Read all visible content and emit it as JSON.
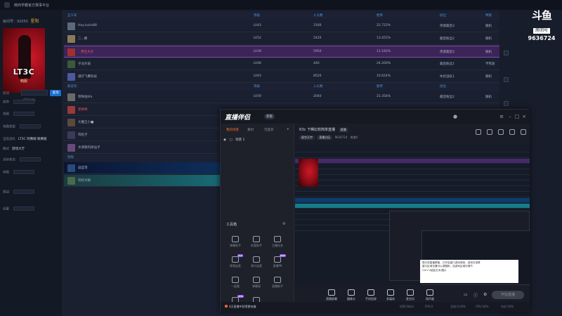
{
  "window": {
    "title": "微商学霸官方赛事平台"
  },
  "left_panel": {
    "room_label": "房间号：92055",
    "room_name": "星阳",
    "poster": {
      "logo_text": "LT3C",
      "sub_text": "韩服"
    },
    "search_label": "房间",
    "search_value": "LT3C战队",
    "search_button": "查询",
    "form_rows": [
      {
        "label": "排序",
        "value": ""
      },
      {
        "label": "地图",
        "value": ""
      },
      {
        "label": "地图类型",
        "value": ""
      },
      {
        "label": "当前战队",
        "value": "LT3C 阿赛姆 联赛服"
      },
      {
        "label": "模式",
        "value": "游戏大厅"
      },
      {
        "label": "当前状态",
        "value": ""
      },
      {
        "label": "地图",
        "value": ""
      },
      {
        "label": "观战",
        "value": ""
      },
      {
        "label": "设置",
        "value": ""
      }
    ]
  },
  "table": {
    "group1": {
      "name": "正义军",
      "cols": [
        "等级",
        "入头数",
        "胜率",
        "段位",
        "种族"
      ]
    },
    "rows1": [
      {
        "name": "Hey.lucks88",
        "level": "LV43",
        "count": "3160",
        "rate": "22.722%",
        "rank": "突袭最后3",
        "race": "随机",
        "avatar": "#5a6a7c"
      },
      {
        "name": "二...娜",
        "level": "LV52",
        "count": "5420",
        "rate": "13.455%",
        "rank": "最后粉丝2",
        "race": "随机",
        "avatar": "#8a7a5b"
      },
      {
        "name": "...帝王大大",
        "level": "LV39",
        "count": "5950",
        "rate": "11.182%",
        "rank": "突袭最后3",
        "race": "随机",
        "avatar": "#a03030",
        "hl": true
      },
      {
        "name": "子龙外居",
        "level": "LV46",
        "count": "440",
        "rate": "24.200%",
        "rank": "最后粉丝1",
        "race": "不死族",
        "avatar": "#3a5a3a"
      },
      {
        "name": "潮汐飞鹰科技",
        "level": "LV63",
        "count": "8520",
        "rate": "10.624%",
        "rank": "失控战队1",
        "race": "随机",
        "avatar": "#4b5a9a"
      }
    ],
    "group2": {
      "name": "邪恶军",
      "cols": [
        "等级",
        "入头数",
        "胜率",
        "段位",
        "种族"
      ]
    },
    "rows2": [
      {
        "name": "惊怖怕life",
        "level": "LV59",
        "count": "2040",
        "rate": "21.356%",
        "rank": "最后粉丝2",
        "race": "随机",
        "avatar": "#6a6a6a"
      },
      {
        "name": "老帅哥",
        "level": "",
        "count": "",
        "rate": "",
        "rank": "",
        "race": "",
        "avatar": "#9a3a3a",
        "red": true
      },
      {
        "name": "大魔王小■",
        "level": "",
        "count": "",
        "rate": "",
        "rank": "",
        "race": "",
        "avatar": "#5a4a3a"
      },
      {
        "name": "肉粒子",
        "level": "",
        "count": "",
        "rate": "",
        "rank": "",
        "race": "",
        "avatar": "#3a3a5a"
      },
      {
        "name": "水调歌的屎仙子",
        "level": "",
        "count": "",
        "rate": "",
        "rank": "",
        "race": "",
        "avatar": "#6a4a7a"
      }
    ],
    "group3": {
      "name": "围观"
    },
    "rows3": [
      {
        "name": "迦蓝雪",
        "avatar": "#2a4a7a",
        "style": "ganme"
      },
      {
        "name": "咬咬大眼",
        "avatar": "#4a6a4a",
        "style": "ganme2"
      }
    ]
  },
  "douyu": {
    "logo": "斗鱼",
    "badge": "房间号",
    "room_no": "9636724"
  },
  "companion": {
    "brand": "直播伴侣",
    "version": "新版",
    "tabs": [
      "我的场景",
      "素材",
      "可直装"
    ],
    "scene": "场景 1",
    "tools_label": "工具箱",
    "tools": [
      {
        "label": "弹幕助手",
        "tag": ""
      },
      {
        "label": "房管助手",
        "tag": ""
      },
      {
        "label": "主播任务",
        "tag": ""
      },
      {
        "label": "视频连麦",
        "tag": "HOT"
      },
      {
        "label": "观众连麦",
        "tag": ""
      },
      {
        "label": "直播PK",
        "tag": "NEW"
      },
      {
        "label": "一起看",
        "tag": ""
      },
      {
        "label": "弹幕塔",
        "tag": ""
      },
      {
        "label": "直播助手",
        "tag": ""
      },
      {
        "label": "特效",
        "tag": "NEW"
      },
      {
        "label": "更多",
        "tag": ""
      }
    ],
    "room_title": "R3c 下棋比较简单直播",
    "room_status": "直播",
    "room_meta_pill1": "星空天宇",
    "room_meta_pill2": "直播分区",
    "room_meta_id": "9636724",
    "room_meta_pop": "热度0",
    "preview_tip": [
      "提示您直播屏幕，已开启窗口游戏录制，游戏在录屏",
      "窗口区域位置可以调整和，如游戏区域可调节",
      "Ctrl+V粘贴文本/图片"
    ],
    "bottom_items": [
      "直播屏幕",
      "摄像头",
      "手机投屏",
      "多媒体",
      "麦克风",
      "扬声器"
    ],
    "go_live": "开始直播",
    "status_tip": "4天直播中获得更有趣",
    "stats": [
      "码率:0kb/s",
      "FPS:0",
      "丢帧:0.00%",
      "CPU:18%",
      "内存:50%"
    ]
  }
}
